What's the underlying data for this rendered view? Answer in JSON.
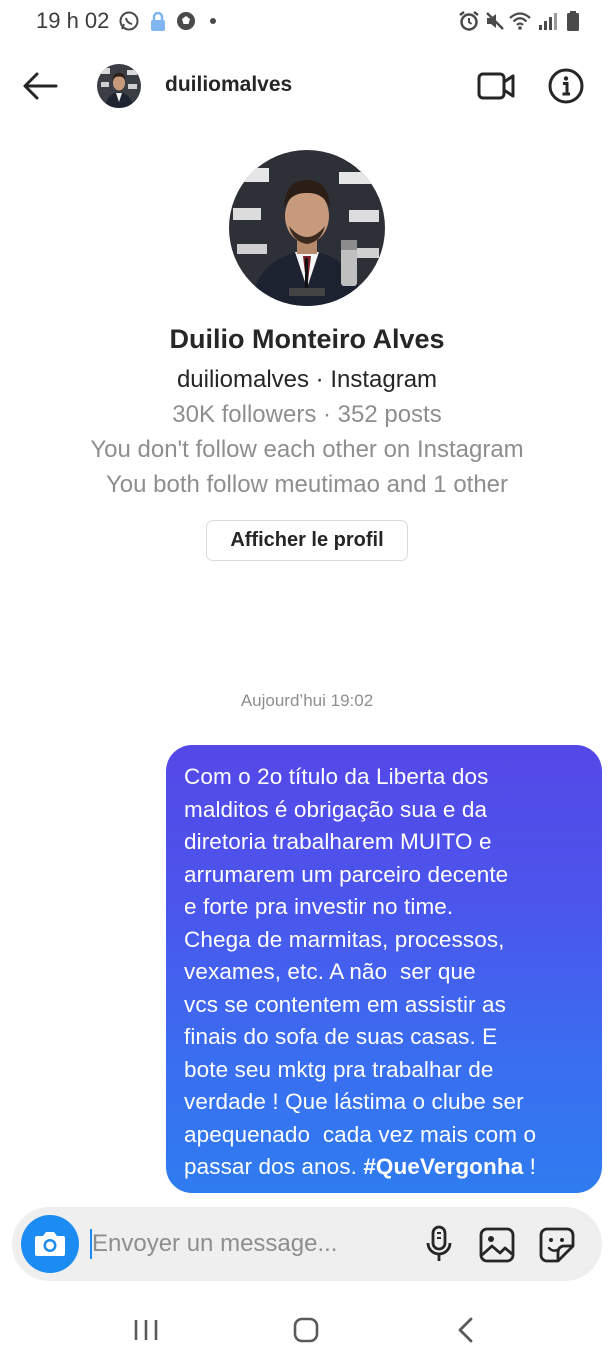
{
  "status_bar": {
    "time": "19 h 02",
    "left_icons": [
      "whatsapp-icon",
      "lock-icon",
      "soccer-ball-icon",
      "dot-icon"
    ],
    "right_icons": [
      "alarm-icon",
      "mute-icon",
      "wifi-icon",
      "signal-icon",
      "battery-icon"
    ]
  },
  "header": {
    "username": "duiliomalves",
    "icons": [
      "back-arrow-icon",
      "video-call-icon",
      "info-icon"
    ]
  },
  "profile": {
    "name": "Duilio Monteiro Alves",
    "handle_line": "duiliomalves · Instagram",
    "stats_line": "30K followers · 352 posts",
    "follow_status": "You don't follow each other on Instagram",
    "mutual_line": "You both follow meutimao and 1 other",
    "view_profile_label": "Afficher le profil"
  },
  "conversation": {
    "timestamp": "Aujourd’hui 19:02",
    "message": {
      "lines": [
        "Com o 2o título da Liberta dos",
        "malditos é obrigação sua e da",
        "diretoria trabalharem MUITO e",
        "arrumarem um parceiro decente",
        "e forte pra investir no time.",
        "Chega de marmitas, processos,",
        "vexames, etc. A não  ser que",
        "vcs se contentem em assistir as",
        "finais do sofa de suas casas. E",
        "bote seu mktg pra trabalhar de",
        "verdade ! Que lástima o clube ser",
        "apequenado  cada vez mais com o"
      ],
      "last_line_prefix": "passar dos anos. ",
      "hashtag": "#QueVergonha",
      "last_line_suffix": " !"
    }
  },
  "composer": {
    "placeholder": "Envoyer un message...",
    "value": "",
    "icons": [
      "camera-icon",
      "microphone-icon",
      "gallery-icon",
      "sticker-icon"
    ]
  },
  "nav_bar": {
    "icons": [
      "recent-apps-icon",
      "home-icon",
      "back-icon"
    ]
  },
  "colors": {
    "accent": "#1c8cf2",
    "bubble_top": "#5548e8",
    "bubble_bottom": "#2f7cf0",
    "secondary_text": "#8e8e8e"
  }
}
